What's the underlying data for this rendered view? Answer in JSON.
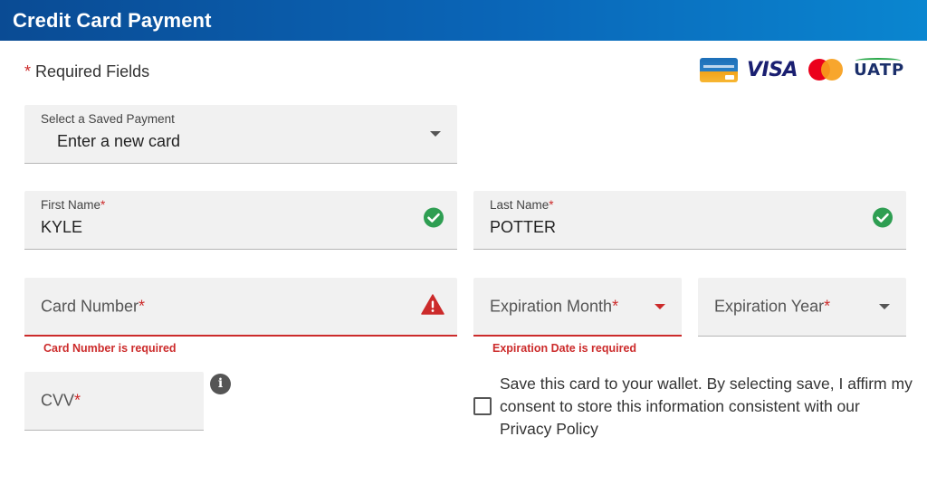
{
  "header": {
    "title": "Credit Card Payment"
  },
  "required": {
    "star": "*",
    "text": "Required Fields"
  },
  "card_logos": {
    "visa": "VISA",
    "uatp": "UATP"
  },
  "saved_payment": {
    "label": "Select a Saved Payment",
    "value": "Enter a new card"
  },
  "first_name": {
    "label": "First Name",
    "star": "*",
    "value": "KYLE",
    "status": "valid"
  },
  "last_name": {
    "label": "Last Name",
    "star": "*",
    "value": "POTTER",
    "status": "valid"
  },
  "card_number": {
    "label": "Card Number",
    "star": "*",
    "error": "Card Number is required"
  },
  "exp_month": {
    "label": "Expiration Month",
    "star": "*",
    "error": "Expiration Date is required"
  },
  "exp_year": {
    "label": "Expiration Year",
    "star": "*"
  },
  "cvv": {
    "label": "CVV",
    "star": "*",
    "info_glyph": "i"
  },
  "save_card": {
    "checked": false,
    "text": "Save this card to your wallet. By selecting save, I affirm my consent to store this information consistent with our Privacy Policy"
  },
  "colors": {
    "header_start": "#0a4b94",
    "header_end": "#0a86d0",
    "error": "#cc2b2b",
    "valid": "#2e9e52"
  }
}
